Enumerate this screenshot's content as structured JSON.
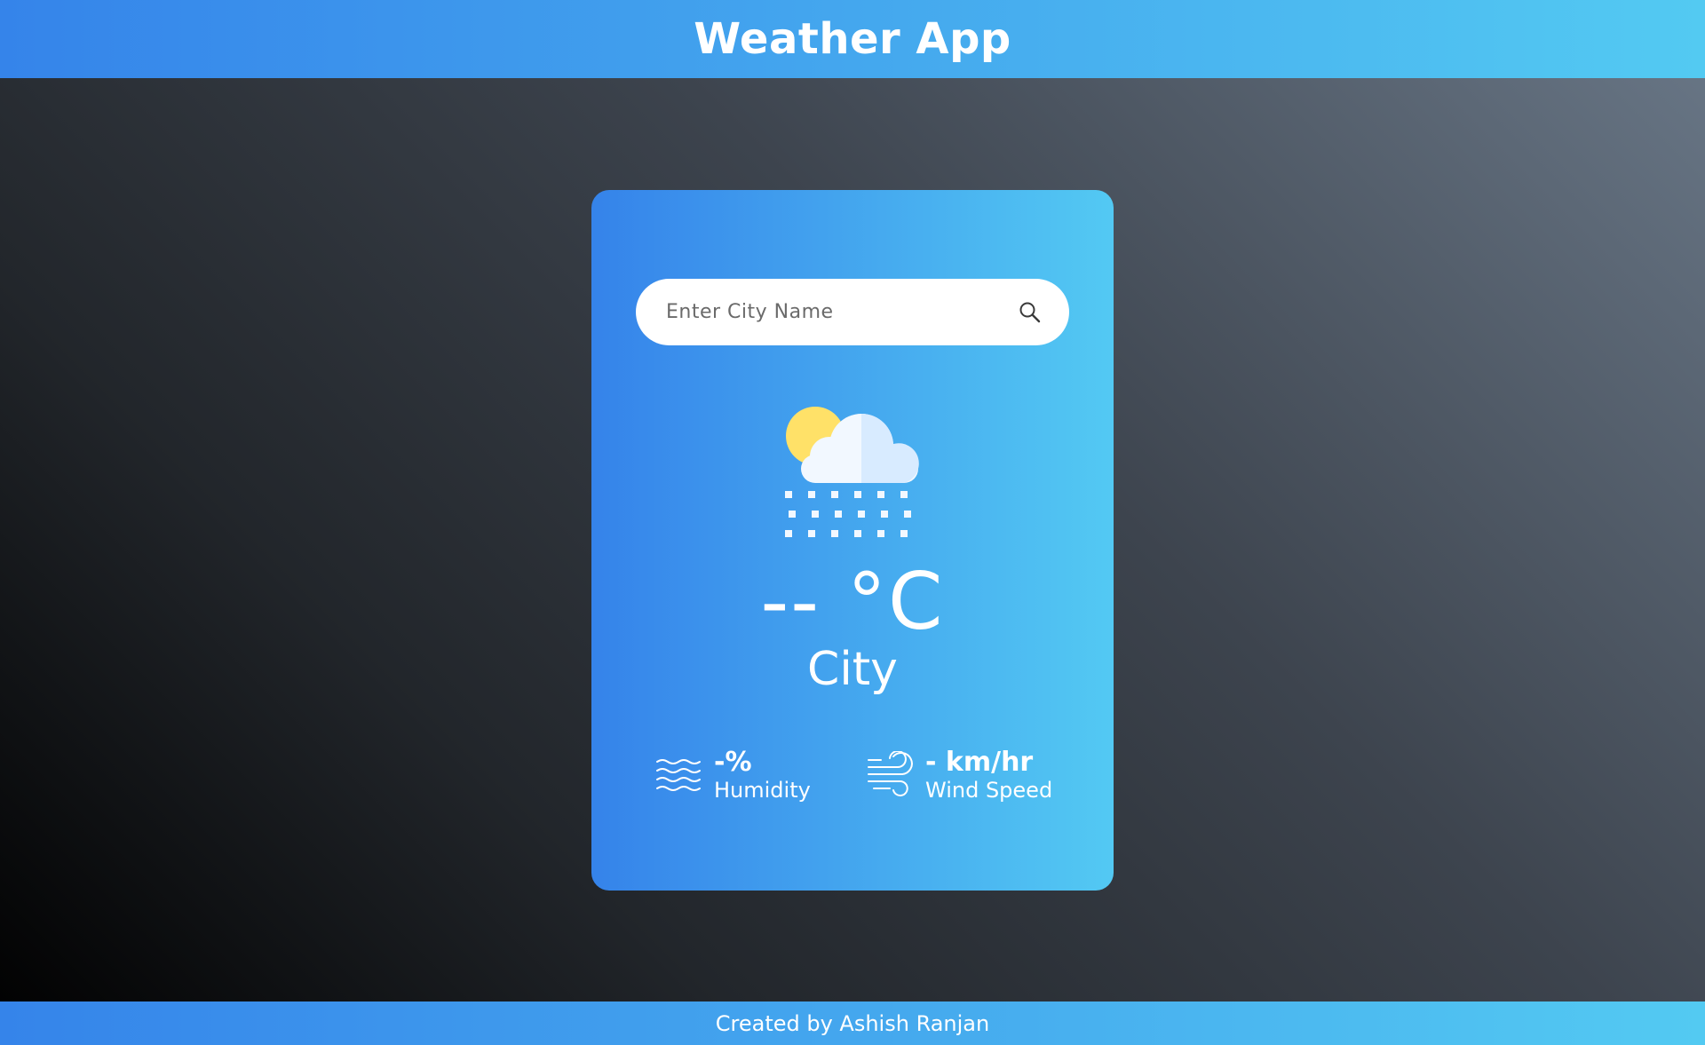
{
  "header": {
    "title": "Weather App"
  },
  "search": {
    "placeholder": "Enter City Name",
    "value": "",
    "icon": "search-icon"
  },
  "weather": {
    "icon": "snow-cloud-sun-icon",
    "temperature": "-- °C",
    "city": "City"
  },
  "details": {
    "humidity": {
      "value": "-%",
      "label": "Humidity",
      "icon": "humidity-waves-icon"
    },
    "wind": {
      "value": "- km/hr",
      "label": "Wind Speed",
      "icon": "wind-icon"
    }
  },
  "footer": {
    "text": "Created by Ashish Ranjan"
  },
  "colors": {
    "accent_start": "#3584ea",
    "accent_end": "#53caf2",
    "background_dark": "#000000",
    "background_light": "#6a7888",
    "sun": "#ffe168",
    "cloud_front": "#f2f8ff",
    "cloud_back": "#d8ebff"
  }
}
